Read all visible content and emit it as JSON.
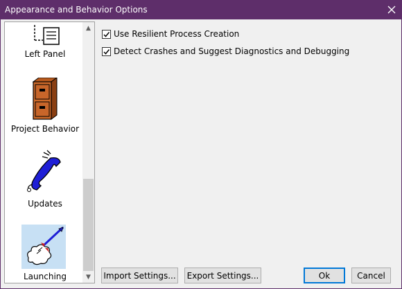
{
  "window": {
    "title": "Appearance and Behavior Options"
  },
  "sidebar": {
    "items": [
      {
        "label": "Left Panel",
        "icon": "left-panel-icon",
        "selected": false
      },
      {
        "label": "Project Behavior",
        "icon": "filing-cabinet-icon",
        "selected": false
      },
      {
        "label": "Updates",
        "icon": "phone-icon",
        "selected": false
      },
      {
        "label": "Launching",
        "icon": "rocket-icon",
        "selected": true
      }
    ]
  },
  "options": [
    {
      "label": "Use Resilient Process Creation",
      "checked": true
    },
    {
      "label": "Detect Crashes and Suggest Diagnostics and Debugging",
      "checked": true
    }
  ],
  "buttons": {
    "import": "Import Settings...",
    "export": "Export Settings...",
    "ok": "Ok",
    "cancel": "Cancel"
  },
  "colors": {
    "titlebar": "#5e2e6a",
    "selection": "#c7e0f4",
    "accent": "#0078d7"
  }
}
